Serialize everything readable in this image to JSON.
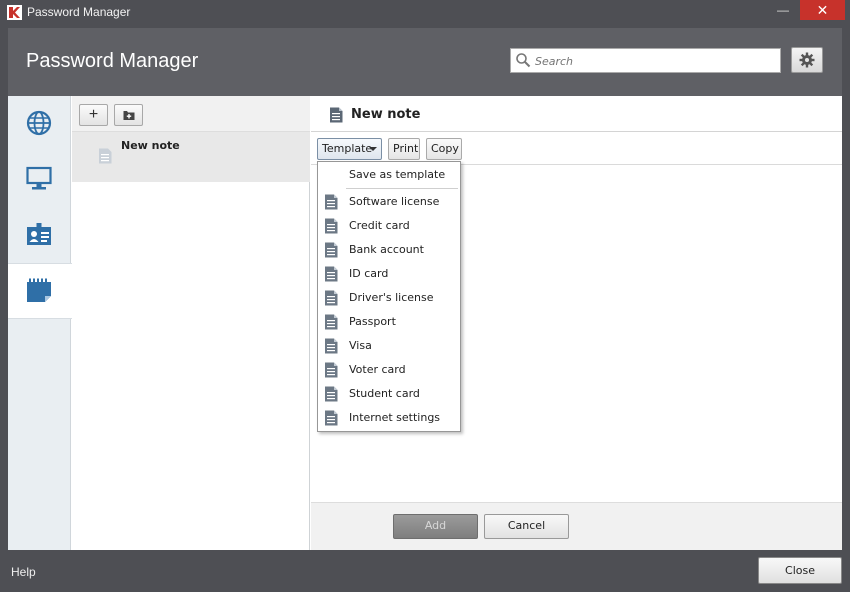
{
  "window": {
    "title": "Password Manager",
    "minimize_glyph": "—",
    "close_glyph": "✕"
  },
  "header": {
    "heading": "Password Manager",
    "search_placeholder": "Search"
  },
  "nav": {
    "items": [
      {
        "icon": "globe-icon"
      },
      {
        "icon": "monitor-icon"
      },
      {
        "icon": "id-card-icon"
      },
      {
        "icon": "notepad-icon",
        "active": true
      }
    ]
  },
  "list": {
    "add_glyph": "+",
    "items": [
      {
        "label": "New note"
      }
    ]
  },
  "detail": {
    "title": "New note",
    "toolbar": {
      "template_label": "Template",
      "print_label": "Print",
      "copy_label": "Copy"
    },
    "footer": {
      "add_label": "Add",
      "cancel_label": "Cancel"
    }
  },
  "template_menu": {
    "save_label": "Save as template",
    "items": [
      "Software license",
      "Credit card",
      "Bank account",
      "ID card",
      "Driver's license",
      "Passport",
      "Visa",
      "Voter card",
      "Student card",
      "Internet settings"
    ]
  },
  "bottom": {
    "help_label": "Help",
    "close_label": "Close"
  },
  "colors": {
    "accent_blue": "#2f6fa7",
    "close_red": "#c7322b",
    "chrome": "#4e4f54"
  }
}
